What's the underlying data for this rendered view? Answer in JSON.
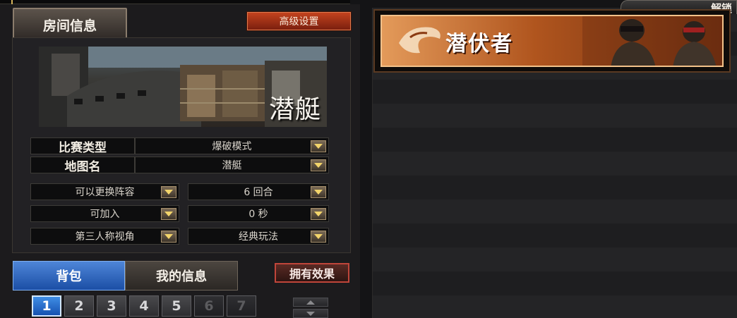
{
  "room_panel": {
    "tab_label": "房间信息",
    "advanced_button": "高级设置",
    "map_name_overlay": "潜艇",
    "settings": {
      "match_type": {
        "label": "比赛类型",
        "value": "爆破模式"
      },
      "map_name": {
        "label": "地图名",
        "value": "潜艇"
      },
      "team_switch": {
        "value": "可以更换阵容"
      },
      "rounds": {
        "value": "6 回合"
      },
      "joinable": {
        "value": "可加入"
      },
      "time": {
        "value": "0 秒"
      },
      "view": {
        "value": "第三人称视角"
      },
      "gameplay": {
        "value": "经典玩法"
      }
    }
  },
  "bottom_bar": {
    "bag_tab": "背包",
    "my_info_tab": "我的信息",
    "effects_button": "拥有效果",
    "pages": [
      "1",
      "2",
      "3",
      "4",
      "5",
      "6",
      "7"
    ],
    "active_page": "1"
  },
  "right_panel": {
    "top_tab_label": "解锁",
    "team_banner_title": "潜伏者"
  },
  "colors": {
    "accent_blue": "#1b4ea5",
    "advanced_red": "#c2431e",
    "banner_orange": "#b0551e",
    "dropdown_arrow": "#f2d46b"
  }
}
